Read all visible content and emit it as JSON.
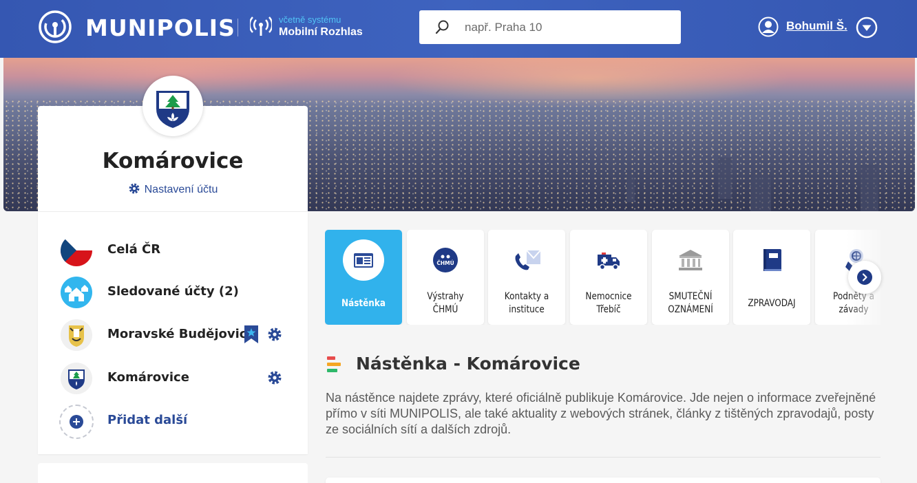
{
  "header": {
    "brand": "MUNIPOLIS",
    "rozhlas_small": "včetně systému",
    "rozhlas_big": "Mobilní Rozhlas",
    "search_placeholder": "např. Praha 10",
    "user_name": "Bohumil Š.",
    "colors": {
      "bar": "#3a5cb8",
      "accent": "#52c4f5"
    }
  },
  "profile": {
    "name": "Komárovice",
    "settings_label": "Nastavení účtu"
  },
  "accounts": {
    "items": [
      {
        "label": "Celá ČR",
        "icon": "czech-flag-icon"
      },
      {
        "label": "Sledované účty (2)",
        "icon": "followed-houses-icon"
      },
      {
        "label": "Moravské Budějovice",
        "icon": "coat-of-arms-icon",
        "bookmarked": true,
        "settings": true
      },
      {
        "label": "Komárovice",
        "icon": "coat-of-arms-icon",
        "settings": true
      }
    ],
    "add_label": "Přidat další"
  },
  "tiles": [
    {
      "label": "Nástěnka",
      "icon": "noticeboard-icon",
      "active": true
    },
    {
      "label": "Výstrahy ČHMÚ",
      "icon": "chmu-icon",
      "active": false,
      "icon_text": "ČHMÚ"
    },
    {
      "label": "Kontakty a instituce",
      "icon": "contacts-icon",
      "active": false
    },
    {
      "label": "Nemocnice Třebíč",
      "icon": "ambulance-icon",
      "active": false
    },
    {
      "label": "SMUTEČNÍ OZNÁMENÍ",
      "icon": "institution-icon",
      "active": false
    },
    {
      "label": "ZPRAVODAJ",
      "icon": "book-icon",
      "active": false
    },
    {
      "label": "Podněty a závady",
      "icon": "report-pin-icon",
      "active": false
    }
  ],
  "board": {
    "title": "Nástěnka - Komárovice",
    "description": "Na nástěnce najdete zprávy, které oficiálně publikuje Komárovice. Jde nejen o informace zveřejněné přímo v síti MUNIPOLIS, ale také aktuality z webových stránek, články z tištěných zpravodajů, posty ze sociálních sítí a dalších zdrojů."
  }
}
